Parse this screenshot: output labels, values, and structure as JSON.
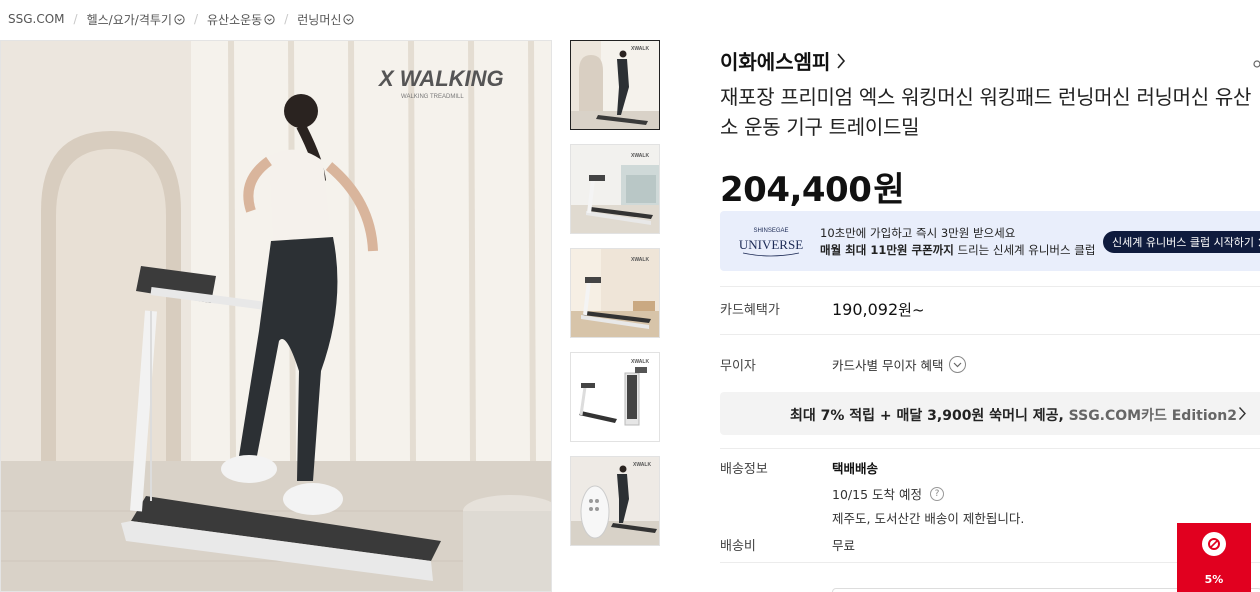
{
  "breadcrumb": {
    "home": "SSG.COM",
    "items": [
      {
        "label": "헬스/요가/격투기"
      },
      {
        "label": "유산소운동"
      },
      {
        "label": "런닝머신"
      }
    ]
  },
  "gallery": {
    "brand_logo": "X WALKING",
    "brand_sub": "WALKING TREADMILL",
    "thumbnails": [
      {
        "alt": "thumbnail-1"
      },
      {
        "alt": "thumbnail-2"
      },
      {
        "alt": "thumbnail-3"
      },
      {
        "alt": "thumbnail-4"
      },
      {
        "alt": "thumbnail-5"
      }
    ],
    "selected_index": 0
  },
  "product": {
    "seller": "이화에스엠피",
    "title": "재포장 프리미엄 엑스 워킹머신 워킹패드 런닝머신 러닝머신 유산소 운동 기구 트레이드밀",
    "price": "204,400",
    "price_unit": "원"
  },
  "universe": {
    "logo_small": "SHINSEGAE",
    "logo_big": "UNIVERSE",
    "line1": "10초만에 가입하고 즉시 3만원 받으세요",
    "line2_bold": "매월 최대 11만원 쿠폰까지",
    "line2_rest": " 드리는 신세계 유니버스 클럽",
    "button": "신세계 유니버스 클럽 시작하기"
  },
  "card_benefit": {
    "label": "카드혜택가",
    "price": "190,092",
    "unit": "원~"
  },
  "interest": {
    "label": "무이자",
    "text": "카드사별 무이자 혜택"
  },
  "promo": {
    "text_bold": "최대 7% 적립 + 매달 3,900원 쑥머니 제공, ",
    "text_gray": "SSG.COM카드 Edition2"
  },
  "shipping": {
    "label": "배송정보",
    "method": "택배배송",
    "date": "10/15 도착 예정",
    "note": "제주도, 도서산간 배송이 제한됩니다.",
    "fee_label": "배송비",
    "fee": "무료"
  },
  "coupon": {
    "percent": "5%"
  },
  "colors": {
    "accent": "#e1001f",
    "universe_bg": "#e9eefb",
    "universe_btn": "#0f1b3d"
  }
}
